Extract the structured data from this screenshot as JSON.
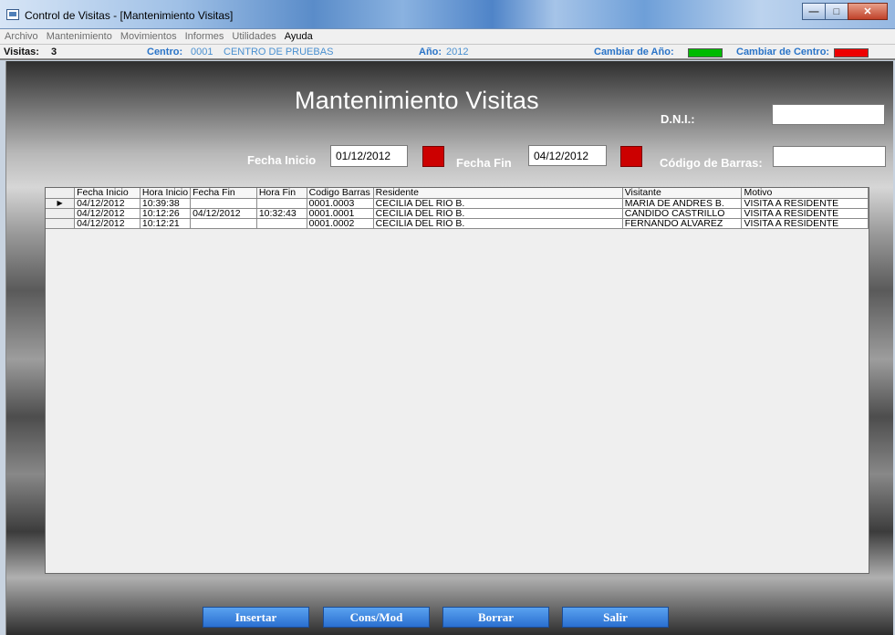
{
  "window": {
    "title": "Control de Visitas - [Mantenimiento Visitas]",
    "minimize_label": "—",
    "maximize_label": "□",
    "close_label": "✕"
  },
  "menu": [
    "Archivo",
    "Mantenimiento",
    "Movimientos",
    "Informes",
    "Utilidades",
    "Ayuda"
  ],
  "status": {
    "visitas_label": "Visitas:",
    "visitas_value": "3",
    "centro_label": "Centro:",
    "centro_code": "0001",
    "centro_name": "CENTRO DE PRUEBAS",
    "anio_label": "Año:",
    "anio_value": "2012",
    "cambiar_anio_label": "Cambiar de Año:",
    "cambiar_centro_label": "Cambiar de Centro:",
    "anio_color": "#00bb00",
    "centro_color": "#ee0000"
  },
  "form": {
    "title": "Mantenimiento Visitas",
    "dni_label": "D.N.I.:",
    "dni_value": "",
    "fecha_inicio_label": "Fecha Inicio",
    "fecha_inicio_value": "01/12/2012",
    "fecha_fin_label": "Fecha Fin",
    "fecha_fin_value": "04/12/2012",
    "codigo_barras_label": "Código de Barras:",
    "codigo_barras_value": ""
  },
  "grid": {
    "columns": [
      "",
      "Fecha Inicio",
      "Hora Inicio",
      "Fecha Fin",
      "Hora Fin",
      "Codigo Barras",
      "Residente",
      "Visitante",
      "Motivo"
    ],
    "current_row_marker": "▶",
    "rows": [
      [
        "04/12/2012",
        "10:39:38",
        "",
        "",
        "0001.0003",
        "CECILIA DEL RIO B.",
        "MARIA DE ANDRES B.",
        "VISITA A RESIDENTE"
      ],
      [
        "04/12/2012",
        "10:12:26",
        "04/12/2012",
        "10:32:43",
        "0001.0001",
        "CECILIA DEL RIO B.",
        "CANDIDO CASTRILLO",
        "VISITA A RESIDENTE"
      ],
      [
        "04/12/2012",
        "10:12:21",
        "",
        "",
        "0001.0002",
        "CECILIA DEL RIO B.",
        "FERNANDO ALVAREZ",
        "VISITA A RESIDENTE"
      ]
    ]
  },
  "buttons": {
    "insertar": "Insertar",
    "consmod": "Cons/Mod",
    "borrar": "Borrar",
    "salir": "Salir"
  }
}
